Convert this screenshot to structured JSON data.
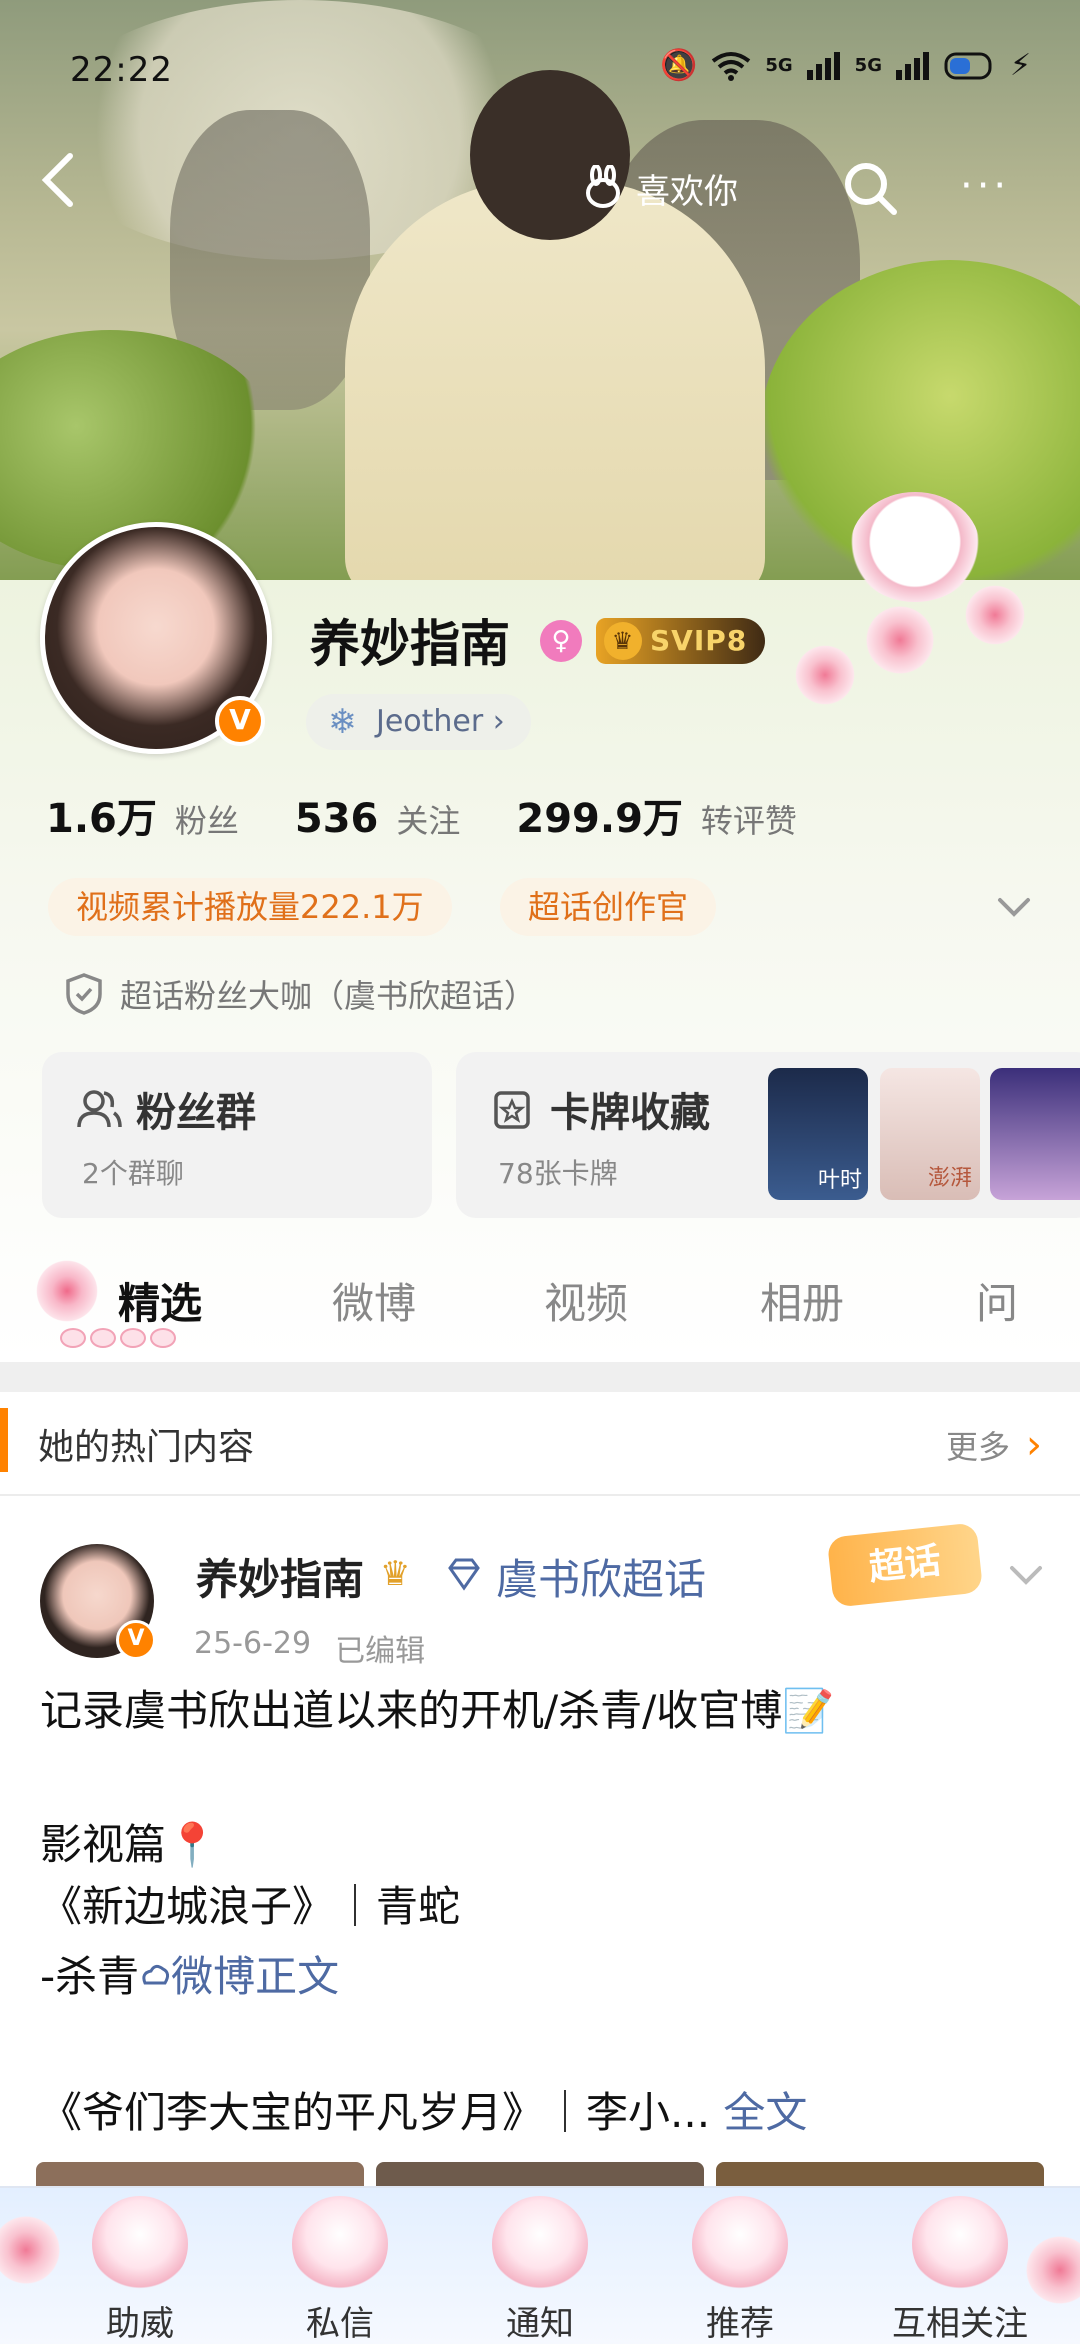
{
  "status_bar": {
    "time": "22:22",
    "net1": "5G",
    "net2": "5G"
  },
  "nav": {
    "back": "<",
    "like_label": "喜欢你",
    "more": "···"
  },
  "profile": {
    "name": "养妙指南",
    "vip_label": "SVIP8",
    "tagline": "Jeother",
    "stats": [
      {
        "num": "1.6万",
        "label": "粉丝"
      },
      {
        "num": "536",
        "label": "关注"
      },
      {
        "num": "299.9万",
        "label": "转评赞"
      }
    ],
    "chips": [
      "视频累计播放量222.1万",
      "超话创作官"
    ],
    "fan_title": "超话粉丝大咖（虞书欣超话）"
  },
  "cards": {
    "group": {
      "title": "粉丝群",
      "sub": "2个群聊"
    },
    "collect": {
      "title": "卡牌收藏",
      "sub": "78张卡牌"
    },
    "thumb_texts": [
      "叶时",
      "澎湃"
    ]
  },
  "tabs": [
    "精选",
    "微博",
    "视频",
    "相册",
    "问"
  ],
  "hot": {
    "title": "她的热门内容",
    "more": "更多"
  },
  "post": {
    "author": "养妙指南",
    "topic": "虞书欣超话",
    "date": "25-6-29",
    "edited": "已编辑",
    "badge": "超话",
    "lines": [
      "记录虞书欣出道以来的开机/杀青/收官博📝",
      "影视篇📍",
      "《新边城浪子》｜青蛇",
      "-杀青",
      "《爷们李大宝的平凡岁月》｜李小..."
    ],
    "link_text": "微博正文",
    "full_text": "全文"
  },
  "bottom_nav": [
    "助威",
    "私信",
    "通知",
    "推荐",
    "互相关注"
  ],
  "colors": {
    "accent": "#ff8200",
    "link": "#4e6aa3",
    "chip_text": "#e0701a"
  }
}
